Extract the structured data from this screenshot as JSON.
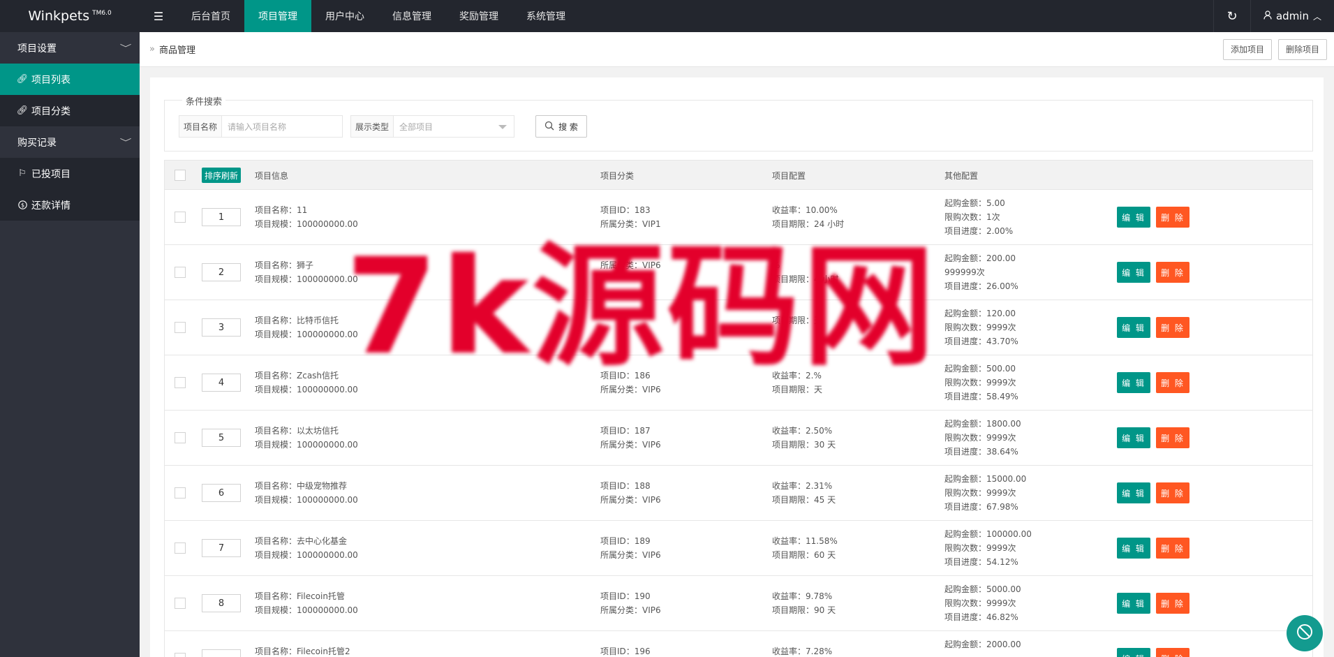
{
  "app": {
    "name": "Winkpets",
    "version": "TM6.0"
  },
  "topnav": {
    "items": [
      {
        "label": "后台首页",
        "active": false
      },
      {
        "label": "项目管理",
        "active": true
      },
      {
        "label": "用户中心",
        "active": false
      },
      {
        "label": "信息管理",
        "active": false
      },
      {
        "label": "奖励管理",
        "active": false
      },
      {
        "label": "系统管理",
        "active": false
      }
    ],
    "user": "admin"
  },
  "sidebar": {
    "groups": [
      {
        "label": "项目设置",
        "items": [
          {
            "label": "项目列表",
            "icon": "link-icon",
            "active": true
          },
          {
            "label": "项目分类",
            "icon": "link-icon",
            "active": false
          }
        ]
      },
      {
        "label": "购买记录",
        "items": [
          {
            "label": "已投项目",
            "icon": "flag-icon",
            "active": false
          },
          {
            "label": "还款详情",
            "icon": "dollar-icon",
            "active": false
          }
        ]
      }
    ]
  },
  "breadcrumb": {
    "current": "商品管理"
  },
  "toolbar": {
    "add_label": "添加项目",
    "delete_label": "删除项目"
  },
  "search": {
    "legend": "条件搜索",
    "name_label": "项目名称",
    "name_placeholder": "请输入项目名称",
    "type_label": "展示类型",
    "type_value": "全部项目",
    "button_label": "搜 索"
  },
  "table": {
    "sort_button": "排序刷新",
    "headers": {
      "info": "项目信息",
      "category": "项目分类",
      "config": "项目配置",
      "other": "其他配置"
    },
    "edit_label": "编 辑",
    "delete_label": "删 除",
    "rows": [
      {
        "sort": "1",
        "name": "项目名称：11",
        "scale": "项目规模：100000000.00",
        "id": "项目ID：183",
        "cat": "所属分类：VIP1",
        "rate": "收益率：10.00%",
        "period": "项目期限：24 小时",
        "min": "起购金额：5.00",
        "limit": "限购次数：1次",
        "progress": "项目进度：2.00%"
      },
      {
        "sort": "2",
        "name": "项目名称：狮子",
        "scale": "项目规模：100000000.00",
        "id": "",
        "cat": "所属分类：VIP6",
        "rate": "%",
        "period": "项目期限：4 小时",
        "min": "起购金额：200.00",
        "limit": "999999次",
        "progress": "项目进度：26.00%"
      },
      {
        "sort": "3",
        "name": "项目名称：比特币信托",
        "scale": "项目规模：100000000.00",
        "id": "",
        "cat": "",
        "rate": "",
        "period": "项目期限：天",
        "min": "起购金额：120.00",
        "limit": "限购次数：9999次",
        "progress": "项目进度：43.70%"
      },
      {
        "sort": "4",
        "name": "项目名称：Zcash信托",
        "scale": "项目规模：100000000.00",
        "id": "项目ID：186",
        "cat": "所属分类：VIP6",
        "rate": "收益率：2.%",
        "period": "项目期限：天",
        "min": "起购金额：500.00",
        "limit": "限购次数：9999次",
        "progress": "项目进度：58.49%"
      },
      {
        "sort": "5",
        "name": "项目名称：以太坊信托",
        "scale": "项目规模：100000000.00",
        "id": "项目ID：187",
        "cat": "所属分类：VIP6",
        "rate": "收益率：2.50%",
        "period": "项目期限：30 天",
        "min": "起购金额：1800.00",
        "limit": "限购次数：9999次",
        "progress": "项目进度：38.64%"
      },
      {
        "sort": "6",
        "name": "项目名称：中级宠物推荐",
        "scale": "项目规模：100000000.00",
        "id": "项目ID：188",
        "cat": "所属分类：VIP6",
        "rate": "收益率：2.31%",
        "period": "项目期限：45 天",
        "min": "起购金额：15000.00",
        "limit": "限购次数：9999次",
        "progress": "项目进度：67.98%"
      },
      {
        "sort": "7",
        "name": "项目名称：去中心化基金",
        "scale": "项目规模：100000000.00",
        "id": "项目ID：189",
        "cat": "所属分类：VIP6",
        "rate": "收益率：11.58%",
        "period": "项目期限：60 天",
        "min": "起购金额：100000.00",
        "limit": "限购次数：9999次",
        "progress": "项目进度：54.12%"
      },
      {
        "sort": "8",
        "name": "项目名称：Filecoin托管",
        "scale": "项目规模：100000000.00",
        "id": "项目ID：190",
        "cat": "所属分类：VIP6",
        "rate": "收益率：9.78%",
        "period": "项目期限：90 天",
        "min": "起购金额：5000.00",
        "limit": "限购次数：9999次",
        "progress": "项目进度：46.82%"
      },
      {
        "sort": "",
        "name": "项目名称：Filecoin托管2",
        "scale": "",
        "id": "项目ID：196",
        "cat": "",
        "rate": "收益率：7.28%",
        "period": "",
        "min": "起购金额：2000.00",
        "limit": "",
        "progress": ""
      }
    ]
  },
  "watermark": "7k源码网",
  "colors": {
    "accent": "#009688",
    "danger": "#ff5722",
    "topbar": "#23262e",
    "sidebar": "#2f323c",
    "watermark": "#e3002b"
  }
}
